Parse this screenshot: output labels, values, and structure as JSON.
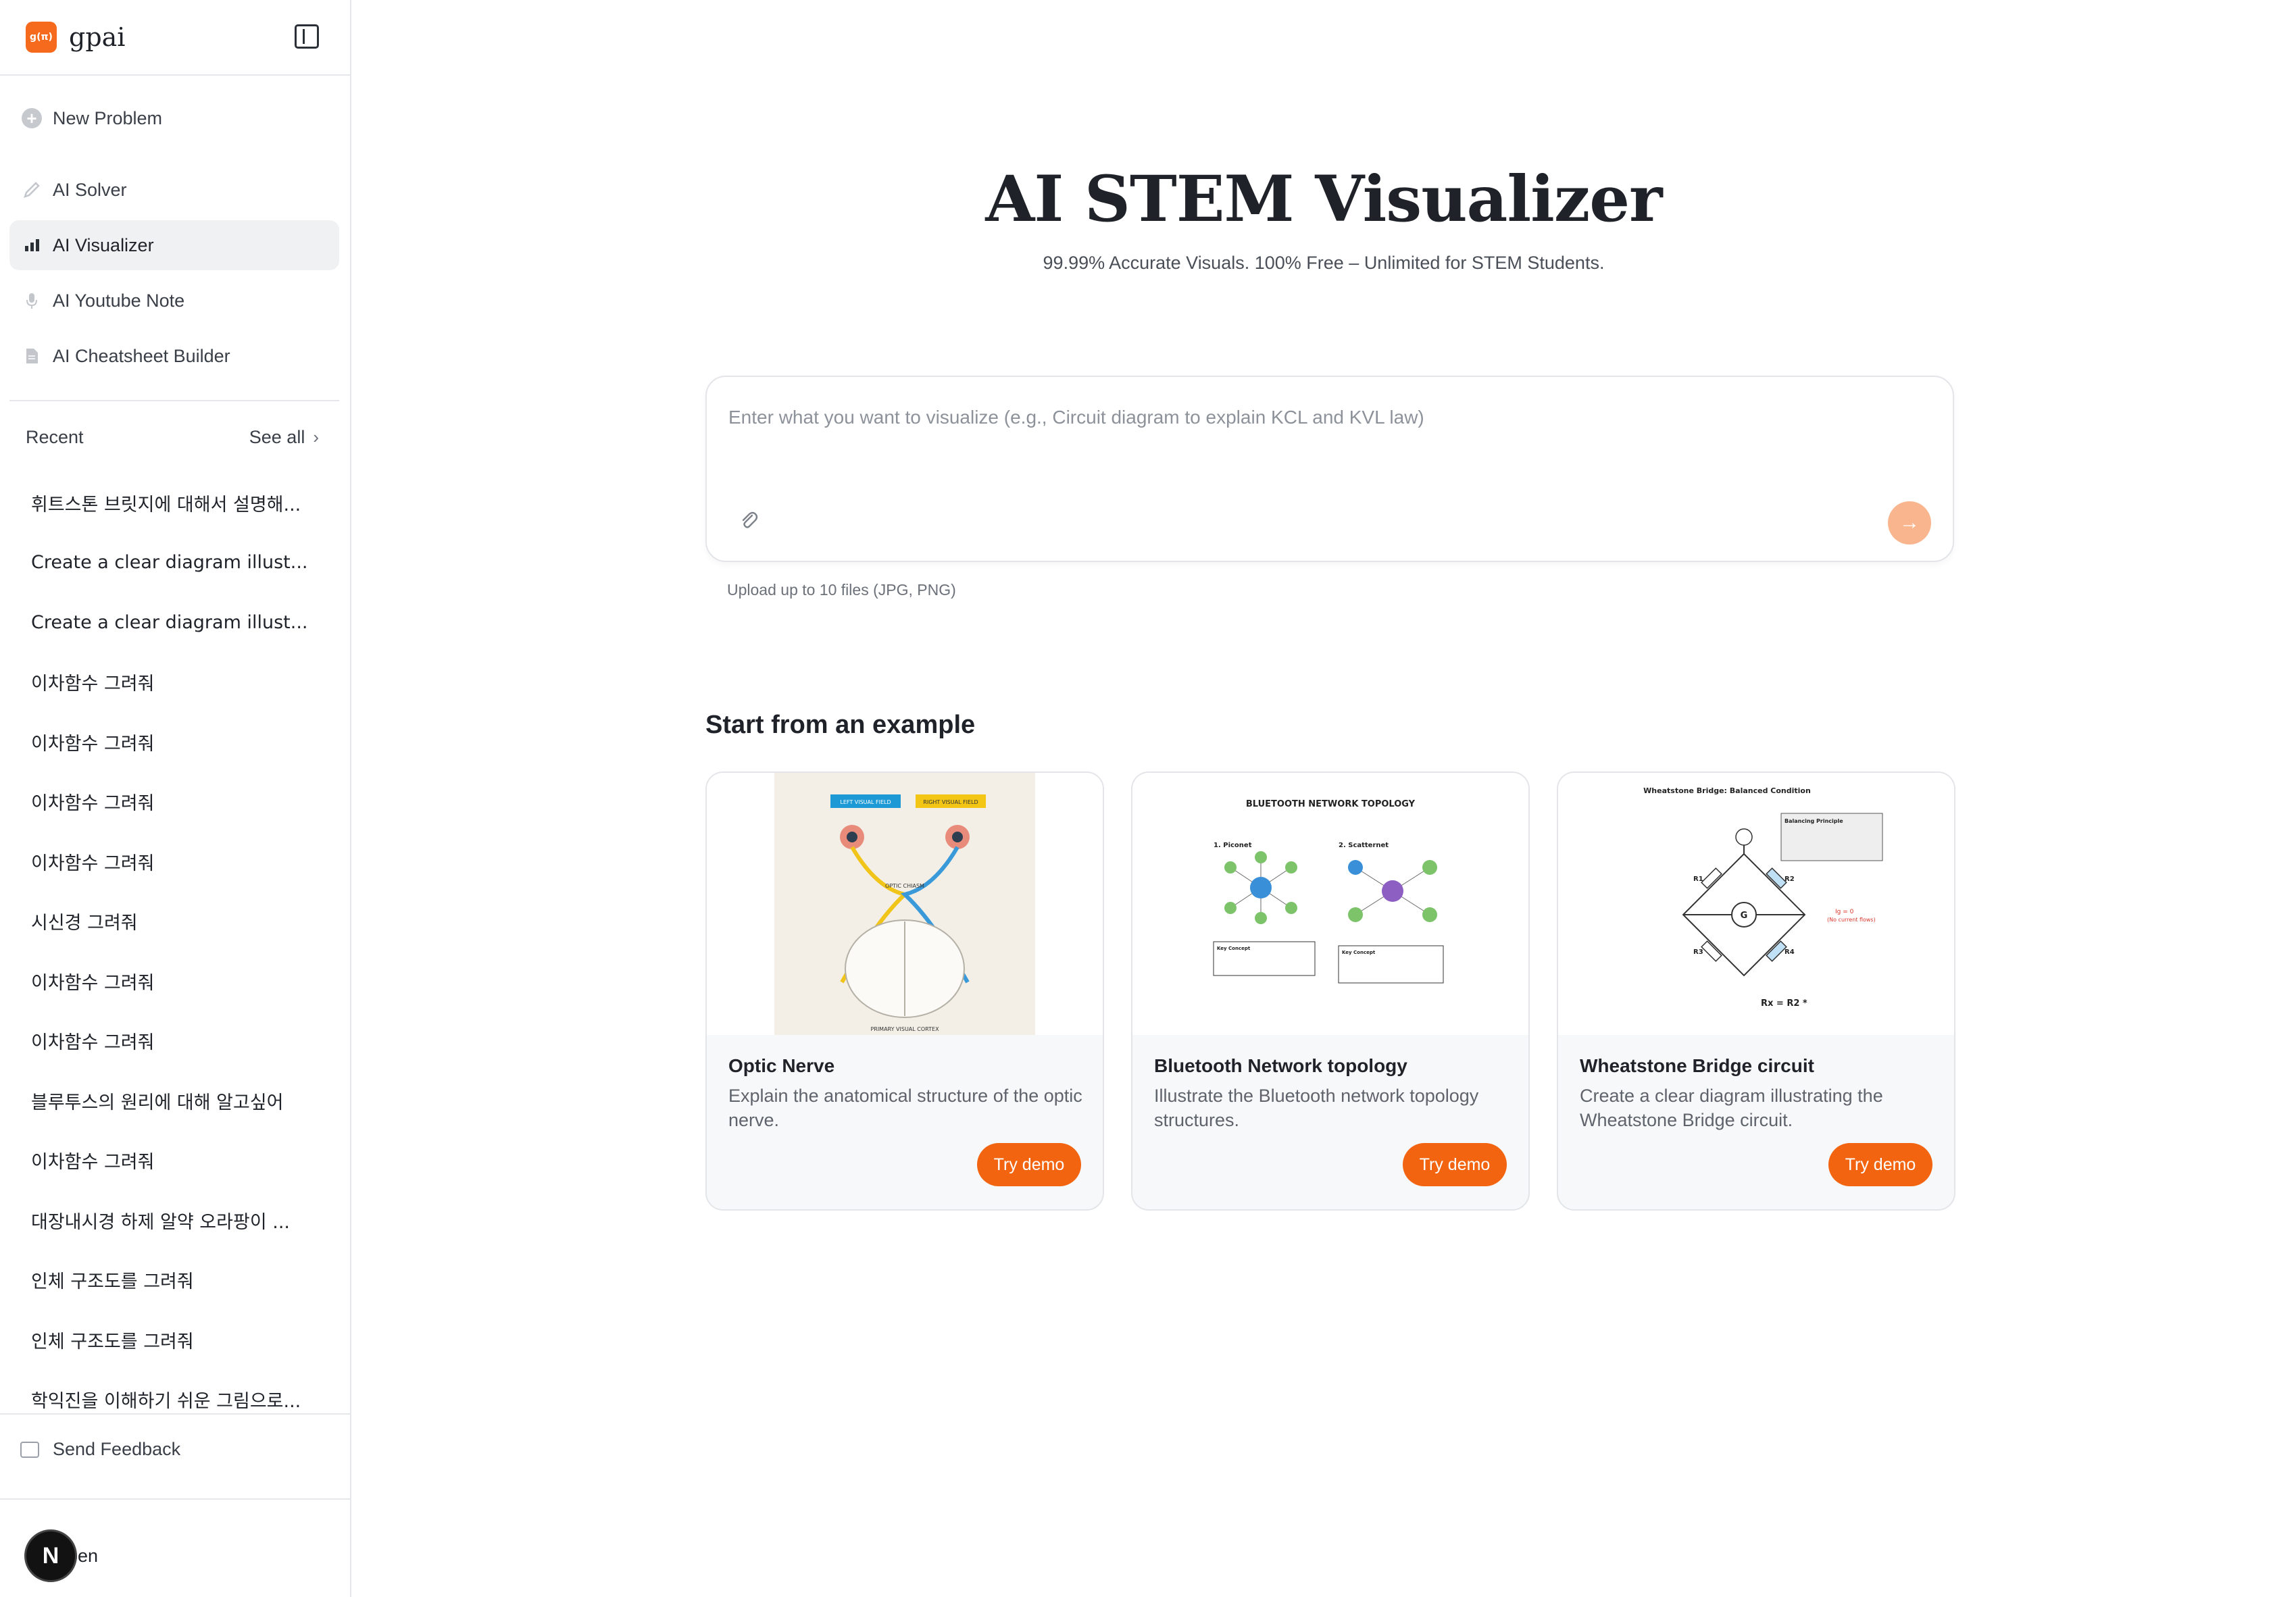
{
  "brand": {
    "logo_text": "g(π)",
    "name": "gpai"
  },
  "nav": {
    "new_problem": "New Problem",
    "items": [
      {
        "label": "AI Solver",
        "icon": "pencil-icon"
      },
      {
        "label": "AI Visualizer",
        "icon": "bar-chart-icon",
        "active": true
      },
      {
        "label": "AI Youtube Note",
        "icon": "microphone-icon"
      },
      {
        "label": "AI Cheatsheet Builder",
        "icon": "document-icon"
      }
    ]
  },
  "recent": {
    "title": "Recent",
    "see_all": "See all",
    "items": [
      "휘트스톤 브릿지에 대해서 설명해...",
      "Create a clear diagram illust...",
      "Create a clear diagram illust...",
      "이차함수 그려줘",
      "이차함수 그려줘",
      "이차함수 그려줘",
      "이차함수 그려줘",
      "시신경 그려줘",
      "이차함수 그려줘",
      "이차함수 그려줘",
      "블루투스의 원리에 대해 알고싶어",
      "이차함수 그려줘",
      "대장내시경 하제 알약 오라팡이 ...",
      "인체 구조도를 그려줘",
      "인체 구조도를 그려줘",
      "학익진을 이해하기 쉬운 그림으로..."
    ]
  },
  "feedback": "Send Feedback",
  "user": {
    "initial": "N",
    "name": "ben"
  },
  "main": {
    "title": "AI STEM Visualizer",
    "subtitle": "99.99% Accurate Visuals. 100% Free – Unlimited for STEM Students.",
    "prompt_placeholder": "Enter what you want to visualize (e.g., Circuit diagram to explain KCL and KVL law)",
    "upload_hint": "Upload up to 10 files (JPG, PNG)",
    "examples_title": "Start from an example",
    "accent": "#f26410"
  },
  "examples": [
    {
      "title": "Optic Nerve",
      "description": "Explain the anatomical structure of the optic nerve.",
      "button": "Try demo",
      "thumb_labels": [
        "LEFT VISUAL FIELD",
        "RIGHT VISUAL FIELD",
        "OPTIC CHIASM",
        "PRIMARY VISUAL CORTEX"
      ]
    },
    {
      "title": "Bluetooth Network topology",
      "description": "Illustrate the Bluetooth network topology structures.",
      "button": "Try demo",
      "thumb_labels": [
        "BLUETOOTH NETWORK TOPOLOGY",
        "1. Piconet",
        "2. Scatternet",
        "Key Concept",
        "Key Concept"
      ]
    },
    {
      "title": "Wheatstone Bridge circuit",
      "description": "Create a clear diagram illustrating the Wheatstone Bridge circuit.",
      "button": "Try demo",
      "thumb_labels": [
        "Wheatstone Bridge: Balanced Condition",
        "Balancing Principle",
        "R1",
        "R2",
        "R3",
        "R4",
        "G",
        "Ig = 0",
        "(No current flows)",
        "Rx = R2 *"
      ]
    }
  ]
}
